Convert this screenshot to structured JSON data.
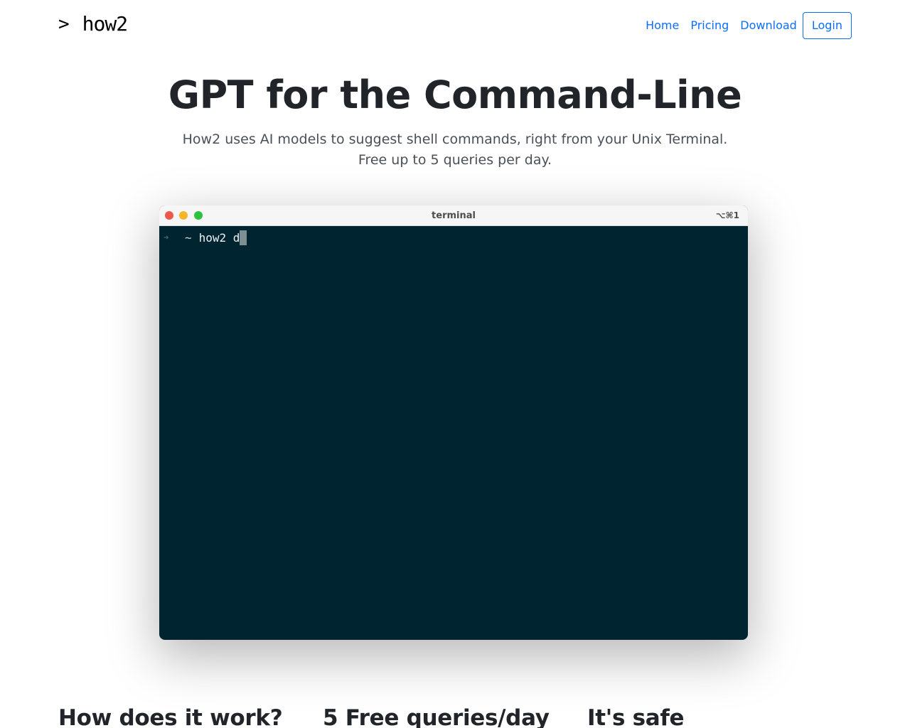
{
  "nav": {
    "brand_caret": ">",
    "brand_name": "how2",
    "links": {
      "home": "Home",
      "pricing": "Pricing",
      "download": "Download",
      "login": "Login"
    }
  },
  "hero": {
    "title": "GPT for the Command-Line",
    "subtitle_line1": "How2 uses AI models to suggest shell commands, right from your Unix Terminal.",
    "subtitle_line2": "Free up to 5 queries per day."
  },
  "terminal": {
    "title": "terminal",
    "shortcut": "⌥⌘1",
    "prompt_arrow": "➜",
    "prompt_dir": "~",
    "command": "how2 d",
    "colors": {
      "background": "#002530",
      "close": "#ed594a",
      "minimize": "#f5b52b",
      "maximize": "#2bc23f"
    }
  },
  "features": {
    "col1": "How does it work?",
    "col2": "5 Free queries/day",
    "col3": "It's safe"
  },
  "colors": {
    "accent": "#0d6efd",
    "heading": "#212529",
    "muted": "#495057"
  }
}
